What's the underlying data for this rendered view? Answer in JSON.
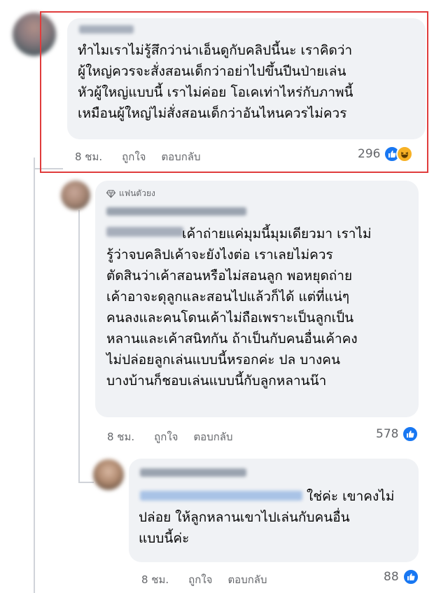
{
  "comments": [
    {
      "author": "",
      "text": [
        "ทำไมเราไม่รู้สึกว่าน่าเอ็นดูกับคลิปนี้นะ เราคิดว่า",
        "ผู้ใหญ่ควรจะสั่งสอนเด็กว่าอย่าไปขึ้นปีนป่ายเล่น",
        "หัวผู้ใหญ่แบบนี้ เราไม่ค่อย โอเคเท่าไหร่กับภาพนี้",
        "เหมือนผู้ใหญ่ไม่สั่งสอนเด็กว่าอันไหนควรไม่ควร"
      ],
      "time": "8 ชม.",
      "like_label": "ถูกใจ",
      "reply_label": "ตอบกลับ",
      "reaction_count": "296",
      "reaction_icons": [
        "like-icon",
        "haha-icon"
      ]
    },
    {
      "badge": "แฟนตัวยง",
      "badge_icon": "diamond-icon",
      "text": [
        "เค้าถ่ายแค่มุมนี้มุมเดียวมา เราไม่",
        "รู้ว่าจบคลิปเค้าจะยังไงต่อ เราเลยไม่ควร",
        "ตัดสินว่าเค้าสอนหรือไม่สอนลูก พอหยุดถ่าย",
        "เค้าอาจะดุลูกและสอนไปแล้วก็ได้ แต่ที่แน่ๆ",
        "คนลงและคนโดนเค้าไม่ถือเพราะเป็นลูกเป็น",
        "หลานและเค้าสนิทกัน ถ้าเป็นกับคนอื่นเค้าคง",
        "ไม่ปล่อยลูกเล่นแบบนี้หรอกค่ะ ปล บางคน",
        "บางบ้านก็ชอบเล่นแบบนี้กับลูกหลานน๊า"
      ],
      "time": "8 ชม.",
      "like_label": "ถูกใจ",
      "reply_label": "ตอบกลับ",
      "reaction_count": "578",
      "reaction_icons": [
        "like-icon"
      ]
    },
    {
      "text": [
        "ใช่ค่ะ เขาคงไม่",
        "ปล่อย ให้ลูกหลานเขาไปเล่นกับคนอื่น",
        "แบบนี้ค่ะ"
      ],
      "time": "8 ชม.",
      "like_label": "ถูกใจ",
      "reply_label": "ตอบกลับ",
      "reaction_count": "88",
      "reaction_icons": [
        "like-icon"
      ]
    }
  ],
  "colors": {
    "highlight_border": "#e03c3c",
    "like_blue": "#1877f2",
    "bubble_bg": "#f0f2f5",
    "meta_gray": "#65676b"
  }
}
